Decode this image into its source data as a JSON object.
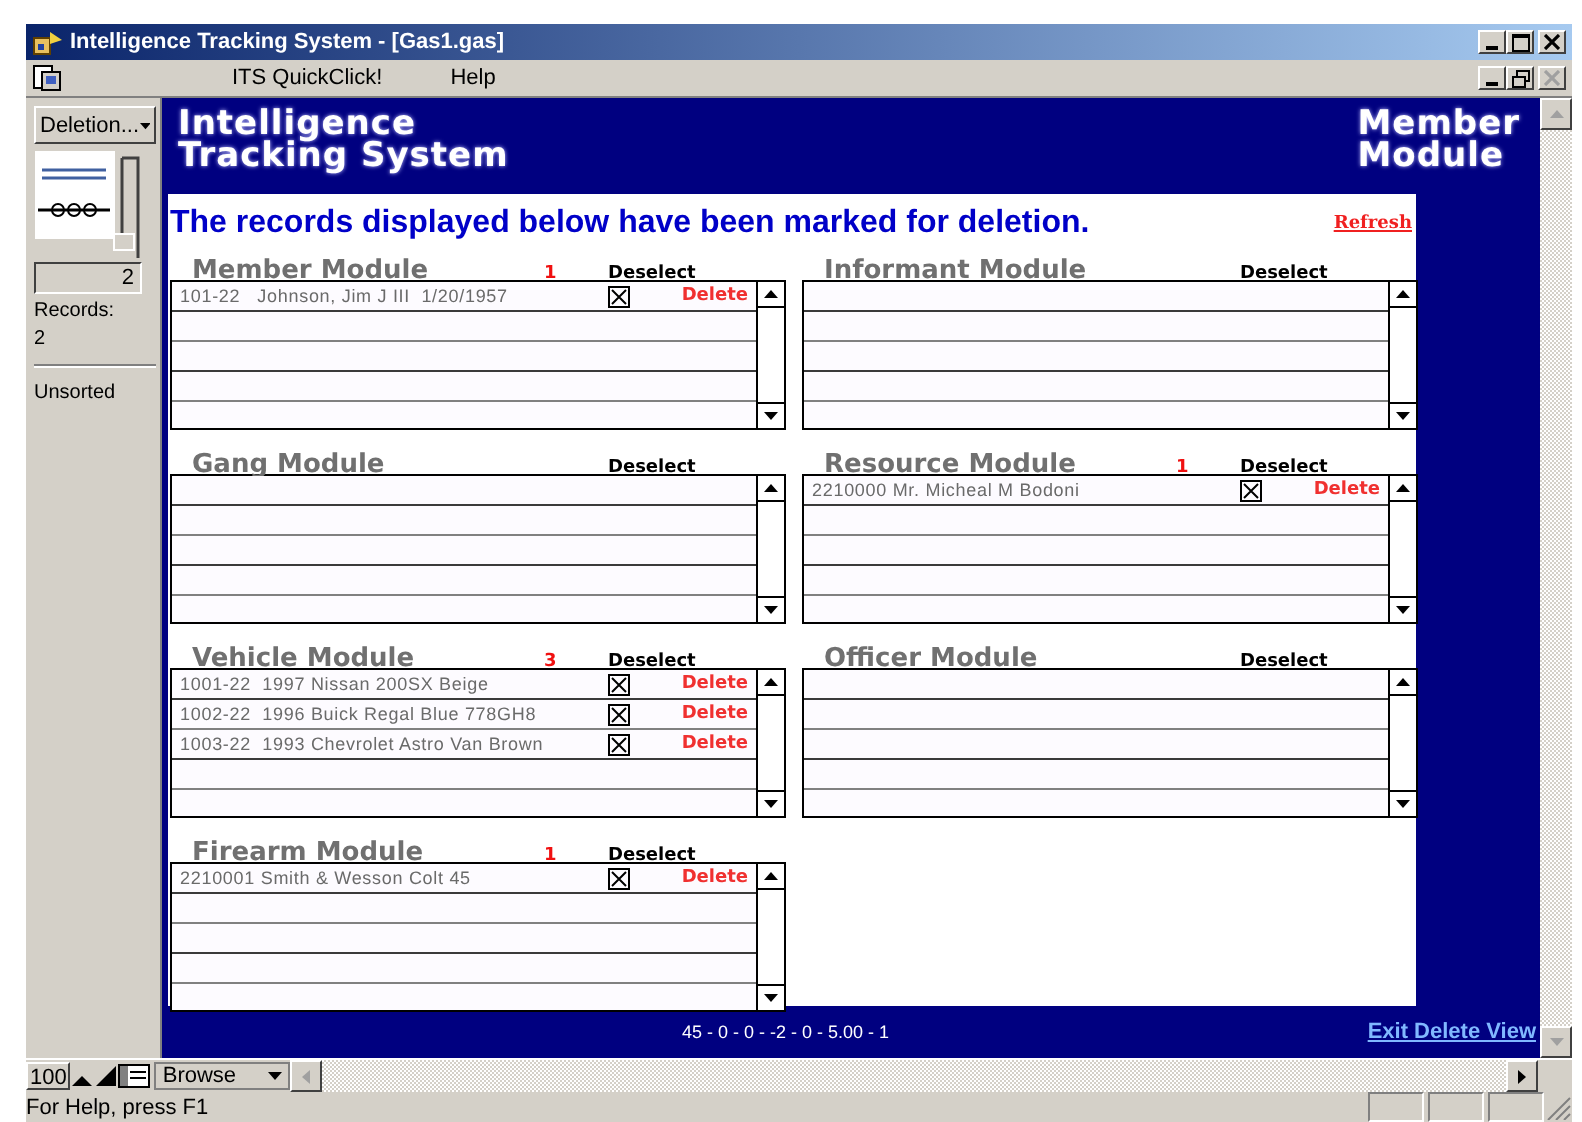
{
  "window": {
    "title": "Intelligence Tracking System - [Gas1.gas]"
  },
  "menu": [
    "ITS QuickClick!",
    "Help"
  ],
  "sidebar": {
    "layout_menu": "Deletion...",
    "book_page": "2",
    "records_label": "Records:",
    "records_count": "2",
    "sort_status": "Unsorted"
  },
  "banner": {
    "title_lines": [
      "Intelligence",
      "Tracking System"
    ],
    "module_lines": [
      "Member",
      "Module"
    ]
  },
  "heading": "The records displayed below have been marked for deletion.",
  "refresh_link": "Refresh",
  "modules": [
    {
      "title": "Member Module",
      "count": "1",
      "deselect": "Deselect",
      "records": [
        {
          "text": "101-22   Johnson, Jim J III  1/20/1957",
          "checked": true,
          "action": "Delete"
        }
      ]
    },
    {
      "title": "Informant Module",
      "deselect": "Deselect"
    },
    {
      "title": "Gang Module",
      "deselect": "Deselect"
    },
    {
      "title": "Resource Module",
      "count": "1",
      "deselect": "Deselect",
      "records": [
        {
          "text": "2210000 Mr. Micheal M Bodoni",
          "checked": true,
          "action": "Delete"
        }
      ]
    },
    {
      "title": "Vehicle Module",
      "count": "3",
      "deselect": "Deselect",
      "records": [
        {
          "text": "1001-22  1997 Nissan 200SX Beige",
          "checked": true,
          "action": "Delete"
        },
        {
          "text": "1002-22  1996 Buick Regal Blue 778GH8",
          "checked": true,
          "action": "Delete"
        },
        {
          "text": "1003-22  1993 Chevrolet Astro Van Brown",
          "checked": true,
          "action": "Delete"
        }
      ]
    },
    {
      "title": "Officer Module",
      "deselect": "Deselect"
    },
    {
      "title": "Firearm Module",
      "count": "1",
      "deselect": "Deselect",
      "records": [
        {
          "text": "2210001 Smith & Wesson Colt 45",
          "checked": true,
          "action": "Delete"
        }
      ]
    }
  ],
  "footer": {
    "summary": "45 - 0 - 0 - -2 - 0 - 5.00 - 1",
    "exit_link": "Exit Delete View"
  },
  "bottom_bar": {
    "zoom": "100",
    "mode": "Browse"
  },
  "status_bar": {
    "text": "For Help, press F1"
  }
}
